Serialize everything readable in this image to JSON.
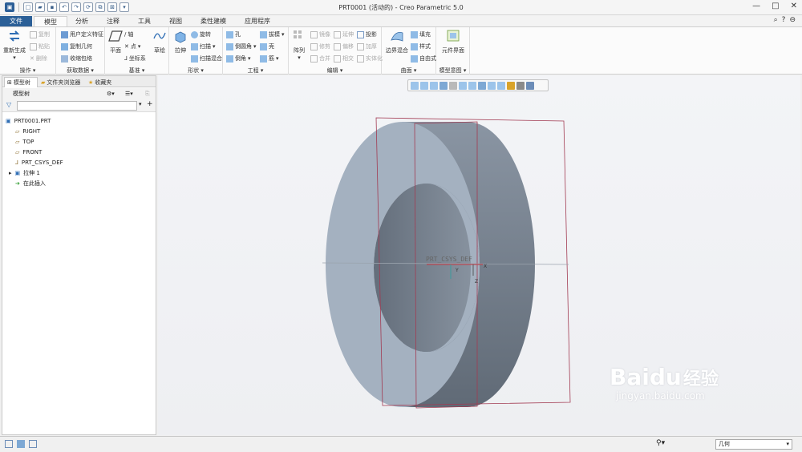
{
  "window": {
    "title": "PRT0001 (活动的) - Creo Parametric 5.0"
  },
  "tabs": [
    "文件",
    "模型",
    "分析",
    "注释",
    "工具",
    "视图",
    "柔性建模",
    "应用程序"
  ],
  "ribbon": {
    "operations": {
      "label": "操作",
      "regenerate": "重新生成",
      "copy": "复制",
      "paste": "粘贴",
      "delete": "删除"
    },
    "getdata": {
      "label": "获取数据",
      "udf": "用户定义特征",
      "copygeom": "复制几何",
      "shrinkwrap": "收缩包络"
    },
    "datum": {
      "label": "基准",
      "plane": "平面",
      "axis": "轴",
      "point": "点",
      "csys": "坐标系",
      "sketch": "草绘"
    },
    "shapes": {
      "label": "形状",
      "extrude": "拉伸",
      "revolve": "旋转",
      "sweep": "扫描",
      "sweptblend": "扫描混合"
    },
    "engineering": {
      "label": "工程",
      "hole": "孔",
      "round": "倒圆角",
      "chamfer": "倒角",
      "draft": "拔模",
      "shell": "壳",
      "rib": "筋"
    },
    "editing": {
      "label": "编辑",
      "pattern": "阵列",
      "mirror": "镜像",
      "trim": "修剪",
      "merge": "合并",
      "extend": "延伸",
      "offset": "偏移",
      "intersect": "相交",
      "project": "投影",
      "thicken": "加厚",
      "solidify": "实体化"
    },
    "surfaces": {
      "label": "曲面",
      "boundary": "边界混合",
      "fill": "填充",
      "style": "样式",
      "freestyle": "自由式"
    },
    "intent": {
      "label": "模型意图",
      "component": "元件界面"
    }
  },
  "navigator": {
    "tabs": [
      "模型树",
      "文件夹浏览器",
      "收藏夹"
    ],
    "header": "模型树",
    "items": [
      "PRT0001.PRT",
      "RIGHT",
      "TOP",
      "FRONT",
      "PRT_CSYS_DEF",
      "拉伸 1",
      "在此插入"
    ]
  },
  "graphics": {
    "csys_label": "PRT_CSYS_DEF",
    "axis_x": "X",
    "axis_y": "Y",
    "axis_z": "Z"
  },
  "status": {
    "selection_filter": "几何"
  },
  "watermark": {
    "brand": "Baidu",
    "suffix": "经验",
    "url": "jingyan.baidu.com"
  },
  "colors": {
    "file_tab": "#2b5f97",
    "solid_face": "#a4b1c0",
    "solid_side": "#7d8896",
    "datum_plane": "#a23b52"
  }
}
